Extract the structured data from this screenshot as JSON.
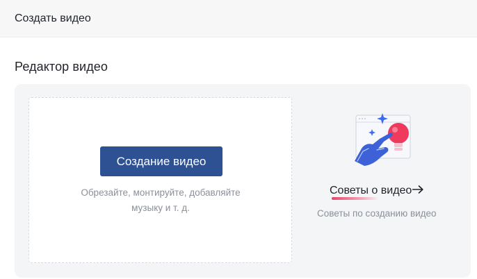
{
  "header": {
    "title": "Создать видео"
  },
  "editor": {
    "title": "Редактор видео",
    "create_button_label": "Создание видео",
    "hint_line1": "Обрезайте, монтируйте, добавляйте",
    "hint_line2": "музыку и т. д."
  },
  "tips": {
    "link_label": "Советы о видео",
    "subtitle": "Советы по созданию видео",
    "illustration_icon": "hand-tapping-lightbulb-icon",
    "arrow_icon": "arrow-right-icon"
  },
  "colors": {
    "primary_button": "#2e5193",
    "accent_red": "#ef3a5d",
    "accent_blue": "#3d6bf0",
    "panel_bg": "#f4f5f7"
  }
}
